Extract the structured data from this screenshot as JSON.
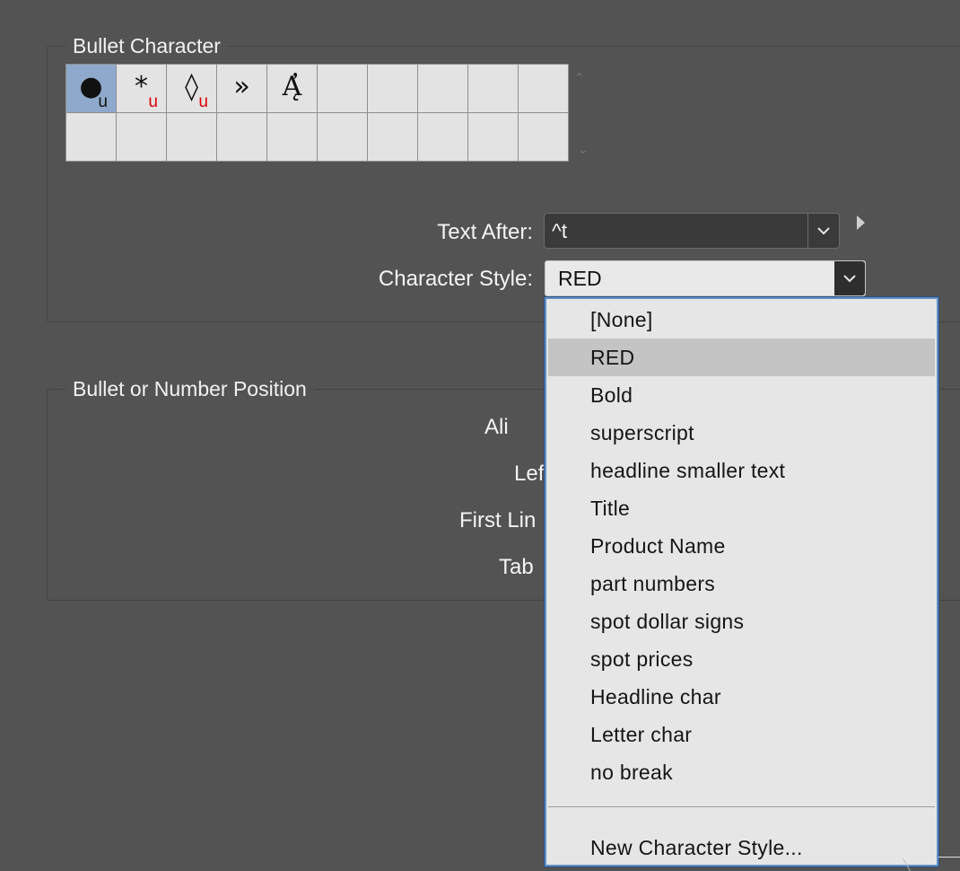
{
  "bullet_character": {
    "title": "Bullet Character",
    "grid": [
      {
        "glyph": "●",
        "sub": "u",
        "selected": true
      },
      {
        "glyph": "*",
        "sub": "u"
      },
      {
        "glyph": "◊",
        "sub": "u"
      },
      {
        "glyph": "»",
        "sub": ""
      },
      {
        "glyph": "Ą̓",
        "sub": ""
      }
    ],
    "text_after_label": "Text After:",
    "text_after_value": "^t",
    "character_style_label": "Character Style:",
    "character_style_value": "RED"
  },
  "position": {
    "title": "Bullet or Number Position",
    "labels": [
      "Ali",
      "Lef",
      "First Lin",
      "Tab"
    ]
  },
  "dropdown": {
    "items": [
      "[None]",
      "RED",
      "Bold",
      "superscript",
      "headline smaller text",
      "Title",
      "Product Name",
      "part numbers",
      "spot dollar signs",
      "spot prices",
      "Headline char",
      "Letter char",
      "no break"
    ],
    "highlighted_index": 1,
    "footer": "New Character Style..."
  },
  "colors": {
    "selection": "#8fa9cc",
    "focus_border": "#5f8fc7",
    "sub_red": "#e00000"
  }
}
